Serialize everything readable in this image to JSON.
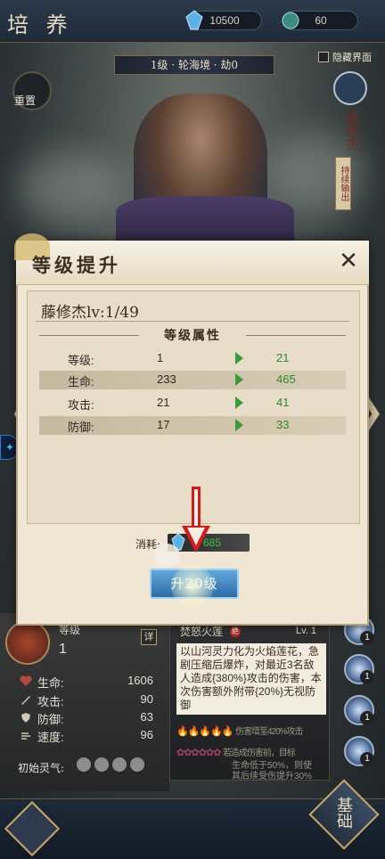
{
  "header": {
    "title": "培 养",
    "currency1": "10500",
    "currency2": "60"
  },
  "level_banner": "1级 · 轮海境 · 劫0",
  "hide_ui_label": "隐藏界面",
  "reset_label": "重置",
  "hero": {
    "name": "藤修杰",
    "tag": "持续输出"
  },
  "dialog": {
    "title": "等级提升",
    "close_glyph": "✕",
    "character_level": "藤修杰lv:1/49",
    "section_title": "等级属性",
    "rows": [
      {
        "label": "等级:",
        "from": "1",
        "to": "21"
      },
      {
        "label": "生命:",
        "from": "233",
        "to": "465"
      },
      {
        "label": "攻击:",
        "from": "21",
        "to": "41"
      },
      {
        "label": "防御:",
        "from": "17",
        "to": "33"
      }
    ],
    "cost_label": "消耗:",
    "cost_value": "685",
    "upgrade_button": "升20级"
  },
  "left_panel": {
    "name": "等级",
    "level": "1",
    "detail_button": "详",
    "stats": [
      {
        "label": "生命:",
        "value": "1606",
        "icon": "heart-icon",
        "color": "#c0392b"
      },
      {
        "label": "攻击:",
        "value": "90",
        "icon": "sword-icon",
        "color": "#d9d2bf"
      },
      {
        "label": "防御:",
        "value": "63",
        "icon": "shield-icon",
        "color": "#d9d2bf"
      },
      {
        "label": "速度:",
        "value": "96",
        "icon": "wind-icon",
        "color": "#d9d2bf"
      }
    ],
    "qi_label": "初始灵气:"
  },
  "skill": {
    "name": "焚怒火莲",
    "tag": "绝",
    "level": "Lv. 1",
    "description": "以山河灵力化为火焰莲花，急剧压缩后爆炸，对最近3名敌人造成{380%}攻击的伤害，本次伤害额外附带{20%}无视防御",
    "line1": "伤害增至420%攻击",
    "line2a": "若造成伤害前，目标",
    "line2b": "生命低于50%，则使",
    "line2c": "其后续受伤提升30%",
    "slots": [
      "1",
      "1",
      "1",
      "1"
    ]
  },
  "bottom": {
    "base_label": "基础"
  },
  "colors": {
    "accent_gold": "#c9a866",
    "upgrade_green": "#2e8a2e",
    "button_blue": "#2c6aa8"
  }
}
